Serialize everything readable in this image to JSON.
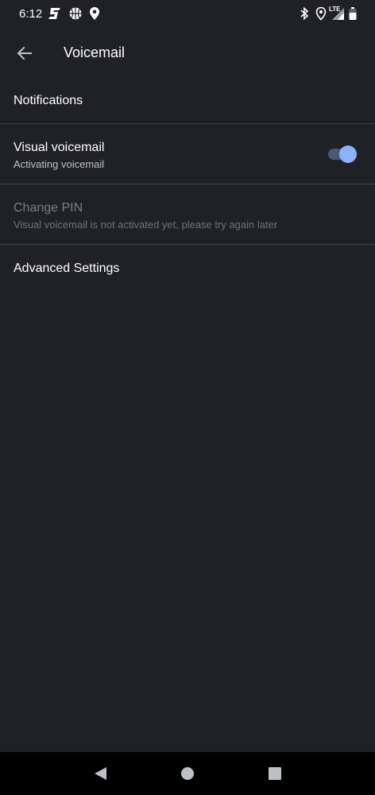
{
  "status_bar": {
    "time": "6:12",
    "icons_left": [
      "sportsnet-icon",
      "basketball-icon",
      "location-pin-icon"
    ],
    "icons_right": [
      "bluetooth-icon",
      "location-icon",
      "lte-signal-icon",
      "battery-icon"
    ],
    "network_label": "LTE"
  },
  "app_bar": {
    "title": "Voicemail",
    "back_icon": "arrow-back-icon"
  },
  "settings": {
    "notifications": {
      "title": "Notifications"
    },
    "visual_voicemail": {
      "title": "Visual voicemail",
      "summary": "Activating voicemail",
      "toggle_on": true
    },
    "change_pin": {
      "title": "Change PIN",
      "summary": "Visual voicemail is not activated yet, please try again later",
      "enabled": false
    },
    "advanced": {
      "title": "Advanced Settings"
    }
  },
  "nav_bar": {
    "buttons": [
      "back-triangle-icon",
      "home-circle-icon",
      "recents-square-icon"
    ]
  },
  "colors": {
    "background": "#202124",
    "accent": "#8ab4f8",
    "toggle_track": "#4a5876",
    "divider": "#3c3f43",
    "summary_text": "#bdc1c6",
    "disabled_text": "#7a7d82"
  }
}
